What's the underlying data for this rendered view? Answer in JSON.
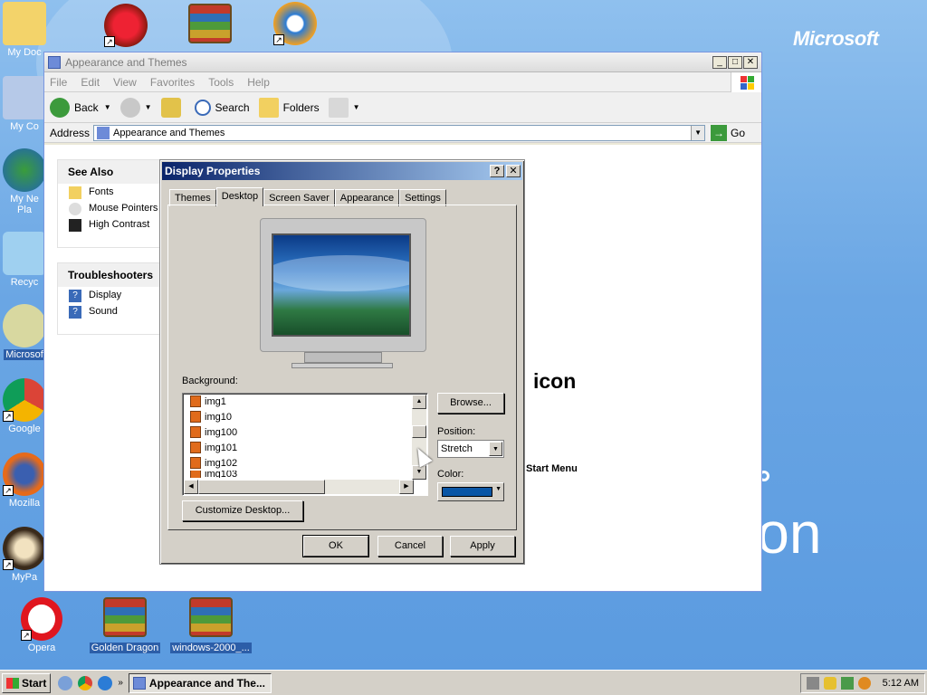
{
  "desktop": {
    "watermark_logo": "Microsoft",
    "watermark_big": "ition",
    "icons_left": [
      {
        "label": "My Doc"
      },
      {
        "label": "My Co"
      },
      {
        "label": "My Ne\nPla"
      },
      {
        "label": "Recyc"
      },
      {
        "label": "Microsof"
      },
      {
        "label": "Google"
      },
      {
        "label": "Mozilla"
      },
      {
        "label": "MyPa"
      }
    ],
    "icons_bottom": [
      {
        "label": "Opera"
      },
      {
        "label": "Golden Dragon"
      },
      {
        "label": "windows-2000_..."
      }
    ]
  },
  "explorer": {
    "title": "Appearance and Themes",
    "menu": [
      "File",
      "Edit",
      "View",
      "Favorites",
      "Tools",
      "Help"
    ],
    "toolbar": {
      "back": "Back",
      "search": "Search",
      "folders": "Folders"
    },
    "address_label": "Address",
    "address_value": "Appearance and Themes",
    "go_label": "Go",
    "see_also": {
      "title": "See Also",
      "items": [
        "Fonts",
        "Mouse Pointers",
        "High Contrast"
      ]
    },
    "troubleshooters": {
      "title": "Troubleshooters",
      "items": [
        "Display",
        "Sound"
      ]
    },
    "bg_text_icon": "icon",
    "bg_text_start": "Start Menu"
  },
  "dialog": {
    "title": "Display Properties",
    "help_btn": "?",
    "close_btn": "✕",
    "tabs": [
      "Themes",
      "Desktop",
      "Screen Saver",
      "Appearance",
      "Settings"
    ],
    "active_tab": "Desktop",
    "background_label": "Background:",
    "background_items": [
      "img1",
      "img10",
      "img100",
      "img101",
      "img102",
      "img103"
    ],
    "browse_label": "Browse...",
    "position_label": "Position:",
    "position_value": "Stretch",
    "color_label": "Color:",
    "color_value": "#0a56a5",
    "customize_label": "Customize Desktop...",
    "ok": "OK",
    "cancel": "Cancel",
    "apply": "Apply"
  },
  "taskbar": {
    "start": "Start",
    "task_label": "Appearance and The...",
    "clock": "5:12 AM"
  }
}
